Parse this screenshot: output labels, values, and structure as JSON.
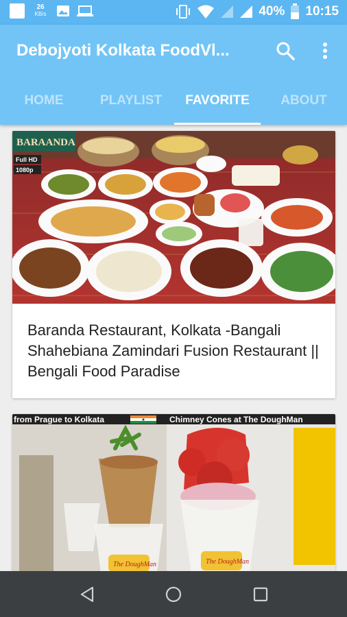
{
  "status_bar": {
    "speed_value": "26",
    "speed_unit": "KB/s",
    "battery_percent": "40%",
    "time": "10:15",
    "icons": [
      "notification-icon",
      "image-icon",
      "laptop-icon",
      "vibrate-icon",
      "wifi-icon",
      "signal-icon",
      "battery-icon"
    ]
  },
  "app_bar": {
    "title": "Debojyoti Kolkata FoodVl...",
    "actions": [
      "search-icon",
      "more-vert-icon"
    ]
  },
  "tabs": [
    {
      "label": "HOME",
      "active": false
    },
    {
      "label": "PLAYLIST",
      "active": false
    },
    {
      "label": "FAVORITE",
      "active": true
    },
    {
      "label": "ABOUT",
      "active": false
    }
  ],
  "videos": [
    {
      "title": "Baranda Restaurant, Kolkata -Bangali Shahebiana Zamindari Fusion Restaurant || Bengali Food Paradise",
      "thumb_brand": "BARAANDA",
      "thumb_badge_hd": "Full HD",
      "thumb_badge_res": "1080p"
    },
    {
      "title": "",
      "thumb_left_caption": "from Prague to Kolkata",
      "thumb_right_caption": "Chimney Cones at The DoughMan",
      "cup_brand": "The DoughMan"
    }
  ],
  "colors": {
    "status_bar": "#5cb6f1",
    "app_bar": "#72c4f6",
    "nav_bar": "#3c3f42"
  }
}
